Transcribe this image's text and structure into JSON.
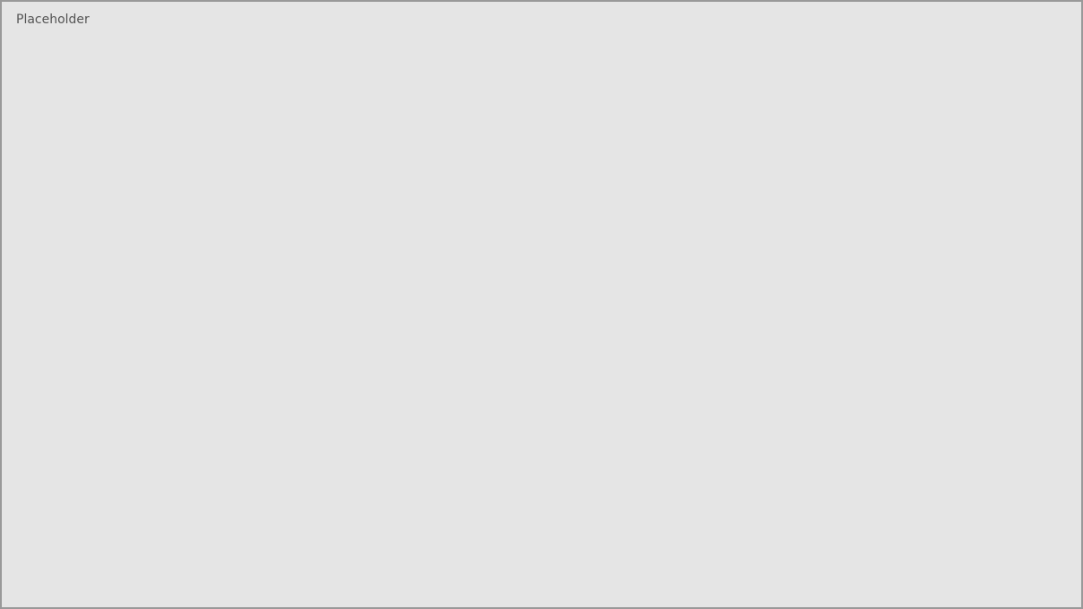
{
  "title": "Placeholder"
}
